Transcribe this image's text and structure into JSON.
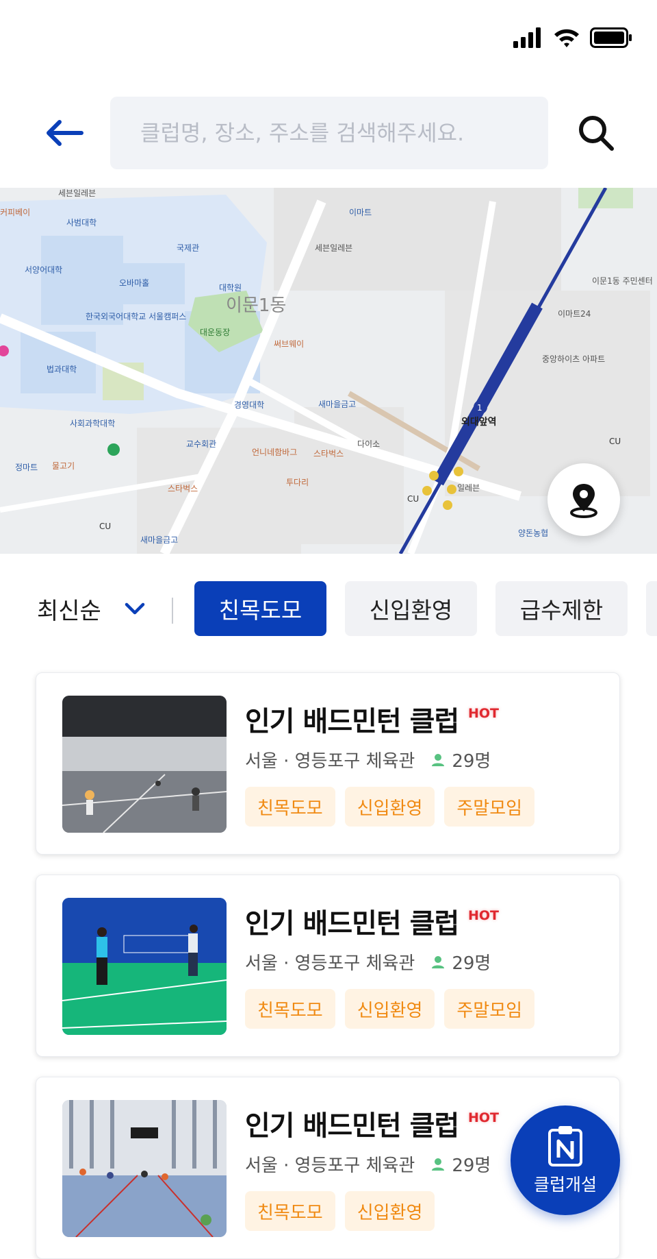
{
  "status_bar": {
    "icons": [
      "signal-icon",
      "wifi-icon",
      "battery-icon"
    ]
  },
  "search": {
    "placeholder": "클럽명, 장소, 주소를 검색해주세요.",
    "back_icon": "arrow-left-icon",
    "search_icon": "search-icon"
  },
  "map": {
    "labels": {
      "dong": "이문1동",
      "station": "외대앞역",
      "univ": "한국외국어대학교\n서울캠퍼스",
      "field": "대운동장",
      "apt": "중앙하이츠\n아파트",
      "center": "이문1동\n주민센터",
      "emart24": "이마트24",
      "subway": "써브웨이",
      "seven": "세븐일레븐",
      "seven2": "세븐일레븐",
      "emart": "이마트",
      "cu1": "CU",
      "cu2": "CU",
      "cu3": "CU",
      "starbucks1": "스타벅스",
      "starbucks2": "스타벅스",
      "saemaeul1": "새마을금고",
      "saemaeul2": "새마을금고",
      "daiso": "다이소",
      "yangdong": "양돈농협",
      "mart": "정마트",
      "law": "법과대학",
      "social": "사회과학대학",
      "sabeom": "사범대학",
      "seoyang": "서양어대학",
      "obama": "오바마홀",
      "gukje": "국제관",
      "daehakwon": "대학원",
      "gyeongyoung": "경영대학",
      "gyosu": "교수회관",
      "coffeebay": "커피베이",
      "gogi": "물고기",
      "eonni": "언니네함바그",
      "tuderi": "투다리",
      "ilrebeun": "일레븐"
    },
    "location_button_icon": "map-pin-icon"
  },
  "filters": {
    "sort_label": "최신순",
    "sort_icon": "chevron-down-icon",
    "chips": [
      {
        "label": "친목도모",
        "active": true
      },
      {
        "label": "신입환영",
        "active": false
      },
      {
        "label": "급수제한",
        "active": false
      }
    ]
  },
  "clubs": [
    {
      "title": "인기 배드민턴 클럽",
      "badge": "HOT",
      "location": "서울 · 영등포구 체육관",
      "members": "29명",
      "tags": [
        "친목도모",
        "신입환영",
        "주말모임"
      ]
    },
    {
      "title": "인기 배드민턴 클럽",
      "badge": "HOT",
      "location": "서울 · 영등포구 체육관",
      "members": "29명",
      "tags": [
        "친목도모",
        "신입환영",
        "주말모임"
      ]
    },
    {
      "title": "인기 배드민턴 클럽",
      "badge": "HOT",
      "location": "서울 · 영등포구 체육관",
      "members": "29명",
      "tags": [
        "친목도모",
        "신입환영"
      ]
    }
  ],
  "fab": {
    "label": "클럽개설",
    "icon": "clipboard-n-icon"
  },
  "colors": {
    "primary": "#0a3fb8",
    "tag_bg": "#fff3e3",
    "tag_text": "#f08a12",
    "hot": "#e0282f",
    "member_icon": "#58c281"
  }
}
